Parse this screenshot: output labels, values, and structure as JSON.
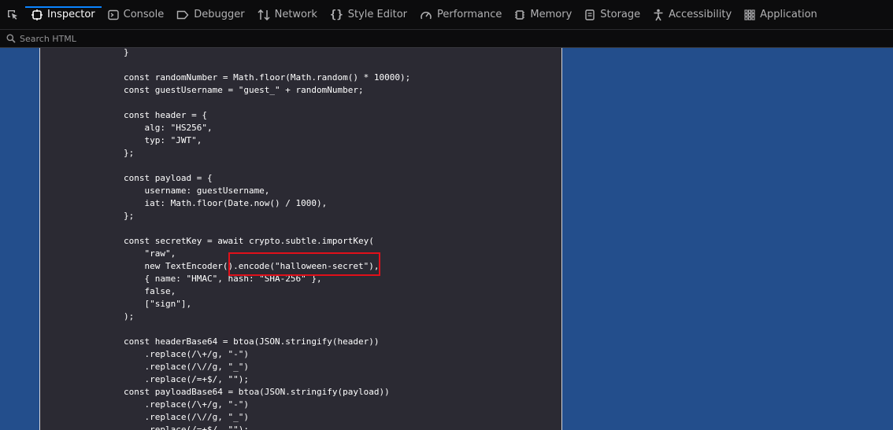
{
  "toolbar": {
    "tabs": [
      {
        "label": "Inspector",
        "icon": "inspector-icon",
        "active": true
      },
      {
        "label": "Console",
        "icon": "console-icon"
      },
      {
        "label": "Debugger",
        "icon": "debugger-icon"
      },
      {
        "label": "Network",
        "icon": "network-icon"
      },
      {
        "label": "Style Editor",
        "icon": "style-editor-icon"
      },
      {
        "label": "Performance",
        "icon": "performance-icon"
      },
      {
        "label": "Memory",
        "icon": "memory-icon"
      },
      {
        "label": "Storage",
        "icon": "storage-icon"
      },
      {
        "label": "Accessibility",
        "icon": "accessibility-icon"
      },
      {
        "label": "Application",
        "icon": "application-icon"
      }
    ]
  },
  "search": {
    "placeholder": "Search HTML"
  },
  "code_lines": [
    "}",
    "",
    "const randomNumber = Math.floor(Math.random() * 10000);",
    "const guestUsername = \"guest_\" + randomNumber;",
    "",
    "const header = {",
    "    alg: \"HS256\",",
    "    typ: \"JWT\",",
    "};",
    "",
    "const payload = {",
    "    username: guestUsername,",
    "    iat: Math.floor(Date.now() / 1000),",
    "};",
    "",
    "const secretKey = await crypto.subtle.importKey(",
    "    \"raw\",",
    "    new TextEncoder().encode(\"halloween-secret\"),",
    "    { name: \"HMAC\", hash: \"SHA-256\" },",
    "    false,",
    "    [\"sign\"],",
    ");",
    "",
    "const headerBase64 = btoa(JSON.stringify(header))",
    "    .replace(/\\+/g, \"-\")",
    "    .replace(/\\//g, \"_\")",
    "    .replace(/=+$/, \"\");",
    "const payloadBase64 = btoa(JSON.stringify(payload))",
    "    .replace(/\\+/g, \"-\")",
    "    .replace(/\\//g, \"_\")",
    "    .replace(/=+$/, \"\");"
  ],
  "colors": {
    "toolbar_bg": "#0c0c0d",
    "page_bg": "#234e8c",
    "code_bg": "#2b2a33",
    "active_tab_indicator": "#0a84ff",
    "highlight": "#e0101a"
  }
}
